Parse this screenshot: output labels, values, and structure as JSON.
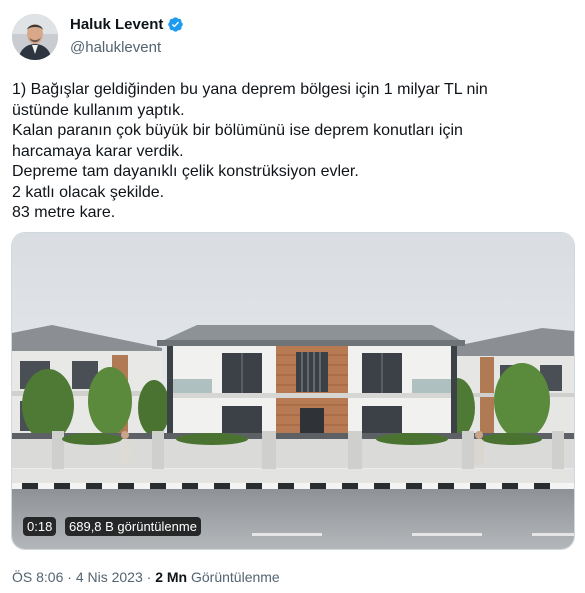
{
  "author": {
    "name": "Haluk Levent",
    "handle": "@haluklevent",
    "verified_icon": "verified-badge-icon"
  },
  "tweet_lines": [
    "1) Bağışlar geldiğinden bu yana deprem bölgesi için 1 milyar TL nin",
    "üstünde kullanım yaptık.",
    "Kalan paranın çok büyük bir bölümünü ise deprem konutları için",
    "harcamaya karar verdik.",
    "Depreme tam dayanıklı çelik konstrüksiyon evler.",
    "2 katlı olacak şekilde.",
    "83 metre kare."
  ],
  "video": {
    "duration": "0:18",
    "views": "689,8 B görüntülenme"
  },
  "footer": {
    "time": "ÖS 8:06",
    "dot": "·",
    "date": "4 Nis 2023",
    "view_count": "2 Mn",
    "view_label": "Görüntülenme"
  },
  "colors": {
    "text": "#0f1419",
    "secondary": "#536471",
    "verified": "#1d9bf0"
  }
}
